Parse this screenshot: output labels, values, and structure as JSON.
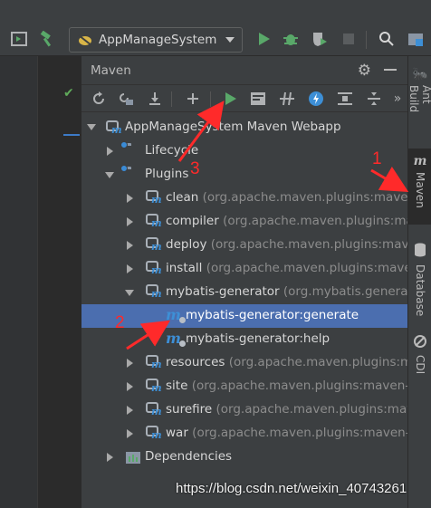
{
  "toolbar": {
    "run_config": "AppManageSystem",
    "icons": [
      "run-window-icon",
      "hammer-icon",
      "ant-config-icon",
      "run-icon",
      "debug-icon",
      "coverage-icon",
      "stop-icon",
      "search-icon",
      "structure-icon"
    ]
  },
  "panel": {
    "title": "Maven",
    "toolbar_buttons": [
      "reload",
      "reimport",
      "download",
      "add",
      "run",
      "execute-goal",
      "toggle-offline",
      "skip-tests",
      "show-dependencies",
      "collapse",
      "more"
    ]
  },
  "tree": {
    "root": "AppManageSystem Maven Webapp",
    "lifecycle": "Lifecycle",
    "plugins": "Plugins",
    "plugin_items": [
      {
        "name": "clean",
        "detail": "(org.apache.maven.plugins:maven-"
      },
      {
        "name": "compiler",
        "detail": "(org.apache.maven.plugins:ma"
      },
      {
        "name": "deploy",
        "detail": "(org.apache.maven.plugins:maven"
      },
      {
        "name": "install",
        "detail": "(org.apache.maven.plugins:mave"
      },
      {
        "name": "mybatis-generator",
        "detail": "(org.mybatis.generato"
      }
    ],
    "goals": [
      "mybatis-generator:generate",
      "mybatis-generator:help"
    ],
    "plugin_items_after": [
      {
        "name": "resources",
        "detail": "(org.apache.maven.plugins:ma"
      },
      {
        "name": "site",
        "detail": "(org.apache.maven.plugins:maven-si"
      },
      {
        "name": "surefire",
        "detail": "(org.apache.maven.plugins:mave"
      },
      {
        "name": "war",
        "detail": "(org.apache.maven.plugins:maven-w"
      }
    ],
    "dependencies": "Dependencies"
  },
  "right_strip": {
    "tabs": [
      "Ant Build",
      "Maven",
      "Database",
      "CDI"
    ]
  },
  "annotations": {
    "n1": "1",
    "n2": "2",
    "n3": "3",
    "color": "#ff2a2a"
  },
  "watermark": "https://blog.csdn.net/weixin_40743261"
}
